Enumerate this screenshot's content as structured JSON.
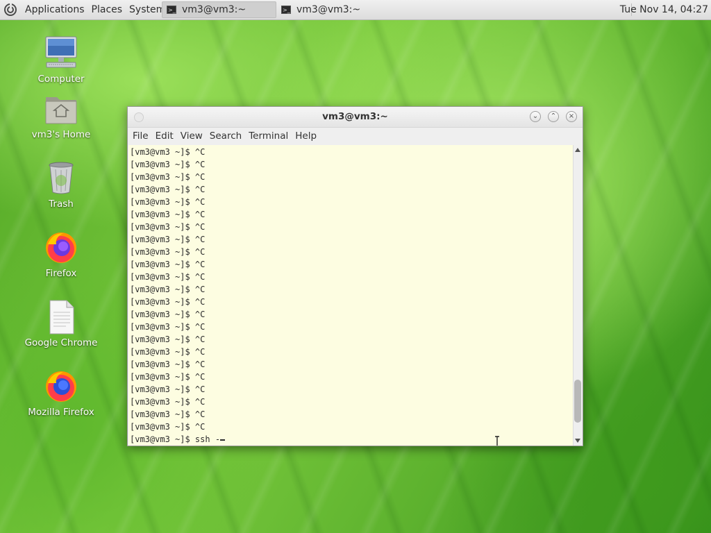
{
  "top_panel": {
    "menus": [
      "Applications",
      "Places",
      "System"
    ],
    "tasks": [
      {
        "label": "vm3@vm3:~",
        "active": true
      },
      {
        "label": "vm3@vm3:~",
        "active": false
      }
    ],
    "clock": "Tue Nov 14, 04:27"
  },
  "desktop_icons": [
    {
      "label": "Computer",
      "icon": "computer-icon"
    },
    {
      "label": "vm3's Home",
      "icon": "home-folder-icon"
    },
    {
      "label": "Trash",
      "icon": "trash-icon"
    },
    {
      "label": "Firefox",
      "icon": "firefox-icon"
    },
    {
      "label": "Google Chrome",
      "icon": "document-icon"
    },
    {
      "label": "Mozilla Firefox",
      "icon": "firefox-icon"
    }
  ],
  "terminal": {
    "title": "vm3@vm3:~",
    "menu": [
      "File",
      "Edit",
      "View",
      "Search",
      "Terminal",
      "Help"
    ],
    "lines": [
      "[vm3@vm3 ~]$ ^C",
      "[vm3@vm3 ~]$ ^C",
      "[vm3@vm3 ~]$ ^C",
      "[vm3@vm3 ~]$ ^C",
      "[vm3@vm3 ~]$ ^C",
      "[vm3@vm3 ~]$ ^C",
      "[vm3@vm3 ~]$ ^C",
      "[vm3@vm3 ~]$ ^C",
      "[vm3@vm3 ~]$ ^C",
      "[vm3@vm3 ~]$ ^C",
      "[vm3@vm3 ~]$ ^C",
      "[vm3@vm3 ~]$ ^C",
      "[vm3@vm3 ~]$ ^C",
      "[vm3@vm3 ~]$ ^C",
      "[vm3@vm3 ~]$ ^C",
      "[vm3@vm3 ~]$ ^C",
      "[vm3@vm3 ~]$ ^C",
      "[vm3@vm3 ~]$ ^C",
      "[vm3@vm3 ~]$ ^C",
      "[vm3@vm3 ~]$ ^C",
      "[vm3@vm3 ~]$ ^C",
      "[vm3@vm3 ~]$ ^C",
      "[vm3@vm3 ~]$ ^C"
    ],
    "current_input": "[vm3@vm3 ~]$ ssh -",
    "background_color": "#fdfde1",
    "scroll_position": 0.95
  }
}
